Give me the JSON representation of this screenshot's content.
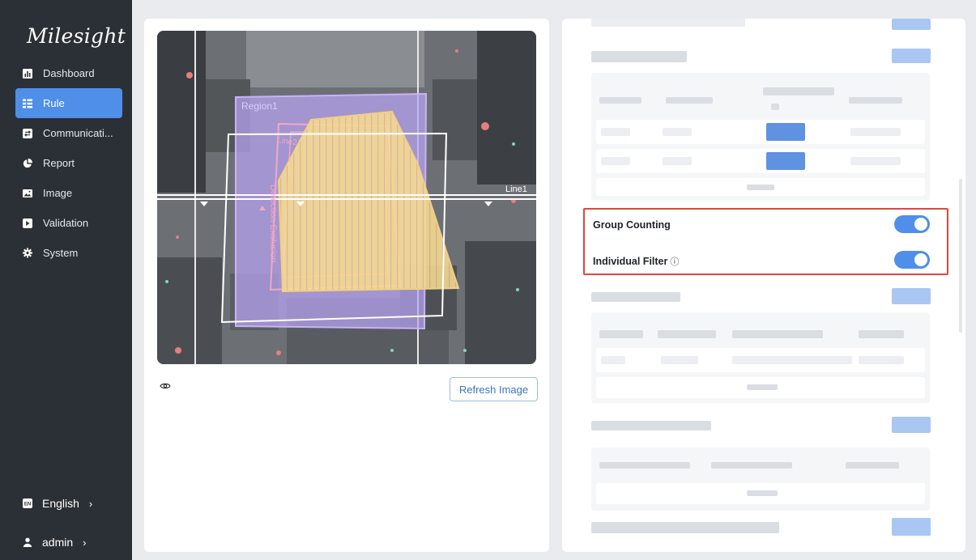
{
  "brand": {
    "name": "Milesight"
  },
  "sidebar": {
    "items": [
      {
        "label": "Dashboard",
        "icon": "bar-chart-icon",
        "active": false
      },
      {
        "label": "Rule",
        "icon": "list-icon",
        "active": true
      },
      {
        "label": "Communicati...",
        "icon": "communication-icon",
        "active": false
      },
      {
        "label": "Report",
        "icon": "pie-chart-icon",
        "active": false
      },
      {
        "label": "Image",
        "icon": "image-icon",
        "active": false
      },
      {
        "label": "Validation",
        "icon": "validation-icon",
        "active": false
      },
      {
        "label": "System",
        "icon": "gear-icon",
        "active": false
      }
    ],
    "language": {
      "label": "English",
      "icon": "language-icon",
      "badge": "EN"
    },
    "user": {
      "label": "admin",
      "icon": "user-icon"
    }
  },
  "camera": {
    "overlays": {
      "region": "Region1",
      "line1": "Line1",
      "line2": "Line2",
      "exclusion": "Detection Exclusion"
    },
    "refresh_label": "Refresh Image",
    "eye_icon": "eye-icon"
  },
  "settings": {
    "group_counting": {
      "label": "Group Counting",
      "enabled": true
    },
    "individual_filter": {
      "label": "Individual Filter",
      "info": "ⓘ",
      "enabled": true
    }
  },
  "colors": {
    "accent": "#4f8fe9",
    "sidebar_bg": "#2b3036",
    "highlight_border": "#e0463e",
    "region_fill": "#b9a3f2",
    "exclusion_fill": "#f7dc8e",
    "line_pink": "#f3a6c6"
  }
}
